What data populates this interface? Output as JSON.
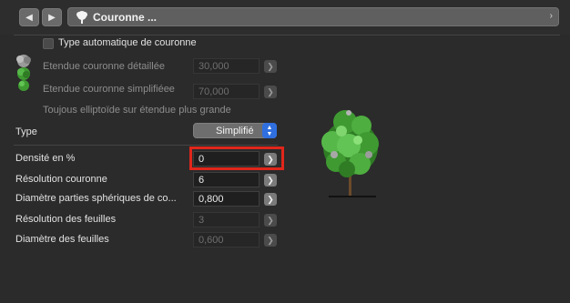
{
  "window": {
    "title": "Couronne ..."
  },
  "crown": {
    "auto_type_label": "Type automatique de couronne",
    "detailed_label": "Etendue couronne détaillée",
    "detailed_value": "30,000",
    "simplified_label": "Etendue couronne simplifiéee",
    "simplified_value": "70,000",
    "ellipsoid_note": "Toujous elliptoïde sur étendue plus grande"
  },
  "params": {
    "type_label": "Type",
    "type_value": "Simplifié",
    "density_label": "Densité en %",
    "density_value": "0",
    "crown_res_label": "Résolution couronne",
    "crown_res_value": "6",
    "sphere_diam_label": "Diamètre parties sphériques de co...",
    "sphere_diam_value": "0,800",
    "leaf_res_label": "Résolution des feuilles",
    "leaf_res_value": "3",
    "leaf_diam_label": "Diamètre des feuilles",
    "leaf_diam_value": "0,600"
  },
  "colors": {
    "panel_bg": "#2b2b2b",
    "highlight": "#e0261b",
    "stepper_accent": "#2f6fe0",
    "foliage": "#3f9a32"
  },
  "icons": [
    "chevron-left-icon",
    "chevron-right-icon",
    "tree-icon",
    "chevron-right-icon",
    "tree-detailed-icon",
    "tree-simplified-icon",
    "tree-preview"
  ]
}
